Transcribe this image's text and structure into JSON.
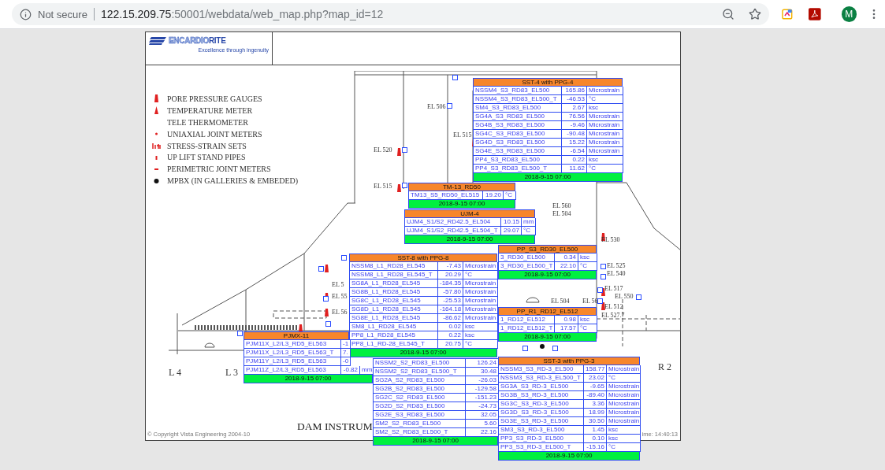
{
  "browser": {
    "security": "Not secure",
    "url_host": "122.15.209.75",
    "url_rest": ":50001/webdata/web_map.php?map_id=12",
    "avatar": "M"
  },
  "logo": {
    "name_a": "ENCARDIO",
    "name_b": "RITE",
    "tagline": "Excellence through ingenuity"
  },
  "legend": [
    {
      "kind": "pore",
      "label": "PORE PRESSURE GAUGES"
    },
    {
      "kind": "temperature",
      "label": "TEMPERATURE METER"
    },
    {
      "kind": "plain",
      "label": "TELE THERMOMETER"
    },
    {
      "kind": "uniaxial",
      "label": "UNIAXIAL JOINT METERS"
    },
    {
      "kind": "stress",
      "label": "STRESS-STRAIN SETS"
    },
    {
      "kind": "uplift",
      "label": "UP LIFT STAND PIPES"
    },
    {
      "kind": "perimetric",
      "label": "PERIMETRIC JOINT METERS"
    },
    {
      "kind": "mpbx",
      "label": "MPBX (IN GALLERIES & EMBEDED)"
    }
  ],
  "elevation_labels": [
    "EL 506",
    "EL 515",
    "EL 520",
    "EL 515",
    "EL 560",
    "EL 504",
    "EL 530",
    "EL 525",
    "EL 540",
    "EL 517",
    "EL 550",
    "EL 512",
    "EL 527.7",
    "EL 504",
    "EL 56",
    "EL 5",
    "EL 55",
    "EL 56"
  ],
  "section_labels": [
    "L 4",
    "L 3",
    "R 2"
  ],
  "drawing_title": "DAM INSTRUM",
  "copyright": "© Copyright Vista Engineering 2004-10",
  "time_label": "ime: 14:40:13",
  "popups": [
    {
      "title": "SST-4 with PPG-4",
      "rows": [
        [
          "NSSM4_S3_RD83_EL500",
          "165.86",
          "Microstrain"
        ],
        [
          "NSSM4_S3_RD83_EL500_T",
          "-46.53",
          "°C"
        ],
        [
          "SM4_S3_RD83_EL500",
          "2.67",
          "ksc"
        ],
        [
          "SG4A_S3_RD83_EL500",
          "76.56",
          "Microstrain"
        ],
        [
          "SG4B_S3_RD83_EL500",
          "-9.46",
          "Microstrain"
        ],
        [
          "SG4C_S3_RD83_EL500",
          "-90.48",
          "Microstrain"
        ],
        [
          "SG4D_S3_RD83_EL500",
          "15.22",
          "Microstrain"
        ],
        [
          "SG4E_S3_RD83_EL500",
          "-6.54",
          "Microstrain"
        ],
        [
          "PP4_S3_RD83_EL500",
          "0.22",
          "ksc"
        ],
        [
          "PP4_S3_RD83_EL500_T",
          "11.62",
          "°C"
        ]
      ],
      "date": "2018-9-15 07:00"
    },
    {
      "title": "TM-13_RD50",
      "rows": [
        [
          "TM13_S5_RD50_EL515",
          "19.20",
          "°C"
        ]
      ],
      "date": "2018-9-15 07:00"
    },
    {
      "title": "UJM-4",
      "rows": [
        [
          "UJM4_S1/S2_RD42.5_EL504",
          "10.15",
          "mm"
        ],
        [
          "UJM4_S1/S2_RD42.5_EL504_T",
          "29.07",
          "°C"
        ]
      ],
      "date": "2018-9-15 07:00"
    },
    {
      "title": "PP_S3_RD30_EL500",
      "rows": [
        [
          "3_RD30_EL500",
          "0.34",
          "ksc"
        ],
        [
          "3_RD30_EL500_T",
          "22.10",
          "°C"
        ]
      ],
      "date": "2018-9-15 07:00"
    },
    {
      "title": "SST-8 with PPG-8",
      "rows": [
        [
          "NSSM8_L1_RD28_EL545",
          "-7.43",
          "Microstrain"
        ],
        [
          "NSSM8_L1_RD28_EL545_T",
          "20.29",
          "°C"
        ],
        [
          "SG8A_L1_RD28_EL545",
          "-184.35",
          "Microstrain"
        ],
        [
          "SG8B_L1_RD28_EL545",
          "-57.80",
          "Microstrain"
        ],
        [
          "SG8C_L1_RD28_EL545",
          "-25.53",
          "Microstrain"
        ],
        [
          "SG8D_L1_RD28_EL545",
          "-164.18",
          "Microstrain"
        ],
        [
          "SG8E_L1_RD28_EL545",
          "-86.62",
          "Microstrain"
        ],
        [
          "SM8_L1_RD28_EL545",
          "0.02",
          "ksc"
        ],
        [
          "PP8_L1_RD28_EL545",
          "0.22",
          "ksc"
        ],
        [
          "PP8_L1_RD-28_EL545_T",
          "20.75",
          "°C"
        ]
      ],
      "date": "2018-9-15 07:00"
    },
    {
      "title": "PP_R1_RD12_EL512",
      "rows": [
        [
          "1_RD12_EL512",
          "0.98",
          "ksc"
        ],
        [
          "1_RD12_EL512_T",
          "17.57",
          "°C"
        ]
      ],
      "date": "2018-9-15 07:00"
    },
    {
      "title": "PJMX-11",
      "rows": [
        [
          "PJM11X_L2/L3_RD5_EL563",
          "-1"
        ],
        [
          "PJM11X_L2/L3_RD5_EL563_T",
          "7."
        ],
        [
          "PJM11Y_L2/L3_RD5_EL563",
          "-0"
        ],
        [
          "PJM11Z_L2/L3_RD5_EL563",
          "-0.82",
          "mm"
        ]
      ],
      "date": "2018-9-15 07:00"
    },
    {
      "rows": [
        [
          "NSSM2_S2_RD83_EL500",
          "126.24"
        ],
        [
          "NSSM2_S2_RD83_EL500_T",
          "30.48"
        ],
        [
          "SG2A_S2_RD83_EL500",
          "-26.03"
        ],
        [
          "SG2B_S2_RD83_EL500",
          "-129.58"
        ],
        [
          "SG2C_S2_RD83_EL500",
          "-151.23"
        ],
        [
          "SG2D_S2_RD83_EL500",
          "-24.73"
        ],
        [
          "SG2E_S3_RD83_EL500",
          "32.05"
        ],
        [
          "SM2_S2_RD83_EL500",
          "5.60"
        ],
        [
          "SM2_S2_RD83_EL500_T",
          "22.16"
        ]
      ],
      "date": "2018-9-15 07:00"
    },
    {
      "title": "SST-3 with PPG-3",
      "rows": [
        [
          "NSSM3_S3_RD-3_EL500",
          "158.77",
          "Microstrain"
        ],
        [
          "NSSM3_S3_RD-3_EL500_T",
          "23.02",
          "°C"
        ],
        [
          "SG3A_S3_RD-3_EL500",
          "-9.65",
          "Microstrain"
        ],
        [
          "SG3B_S3_RD-3_EL500",
          "-89.40",
          "Microstrain"
        ],
        [
          "SG3C_S3_RD-3_EL500",
          "3.36",
          "Microstrain"
        ],
        [
          "SG3D_S3_RD-3_EL500",
          "18.99",
          "Microstrain"
        ],
        [
          "SG3E_S3_RD-3_EL500",
          "30.50",
          "Microstrain"
        ],
        [
          "SM3_S3_RD-3_EL500",
          "1.45",
          "ksc"
        ],
        [
          "PP3_S3_RD-3_EL500",
          "0.10",
          "ksc"
        ],
        [
          "PP3_S3_RD-3_EL500_T",
          "-15.16",
          "°C"
        ]
      ],
      "date": "2018-9-15 07:00"
    }
  ]
}
